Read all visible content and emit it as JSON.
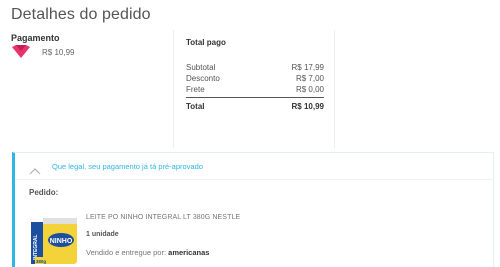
{
  "page_title": "Detalhes do pedido",
  "payment": {
    "label": "Pagamento",
    "icon": "card-brand-icon",
    "amount": "R$ 10,99"
  },
  "summary": {
    "title": "Total pago",
    "rows": [
      {
        "label": "Subtotal",
        "value": "R$ 17,99"
      },
      {
        "label": "Desconto",
        "value": "R$ 7,00"
      },
      {
        "label": "Frete",
        "value": "R$ 0,00"
      }
    ],
    "total_label": "Total",
    "total_value": "R$ 10,99"
  },
  "approval": {
    "message": "Que legal, seu pagamento já tá pré-aprovado",
    "icon": "chevron-up-icon",
    "accent_color": "#2fb6e5"
  },
  "order": {
    "label": "Pedido:",
    "product": {
      "name": "LEITE PO NINHO INTEGRAL LT 380G NESTLE",
      "quantity": "1 unidade",
      "seller_prefix": "Vendido e entregue por:",
      "seller_name": "americanas",
      "image_label": "NINHO",
      "image_sub": "INTEGRAL",
      "image_weight": "380g"
    }
  },
  "colors": {
    "brand_pink": "#e8336b",
    "accent_blue": "#2fb6e5"
  }
}
